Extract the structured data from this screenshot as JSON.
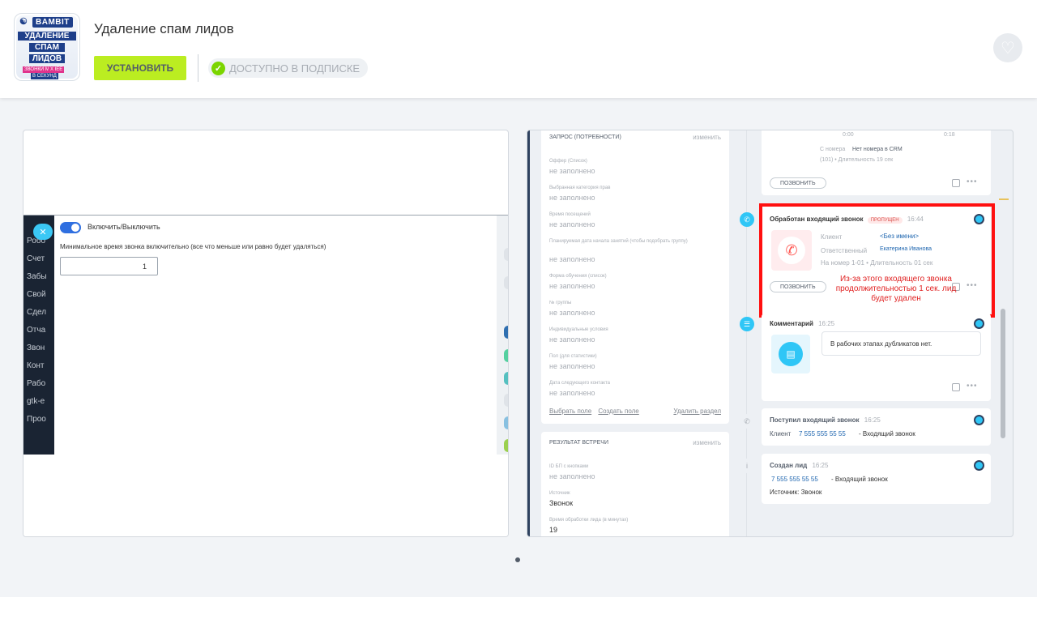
{
  "app": {
    "title": "Удаление спам лидов",
    "install_label": "УСТАНОВИТЬ",
    "subscription_label": "ДОСТУПНО В ПОДПИСКЕ",
    "logo": {
      "brand": "BAMBIT",
      "line1": "УДАЛЕНИЕ",
      "line2": "СПАМ",
      "line3": "ЛИДОВ",
      "tag1": "ЗВОНКИ МЕНЕЕ",
      "tag2": "Х",
      "tag3": "В СЕКУНД"
    },
    "icons": {
      "favorite": "heart-icon",
      "check": "check-icon"
    },
    "colors": {
      "install": "#bbed21",
      "check": "#7bd500",
      "toggle": "#2f6fe0",
      "highlight": "#ff1010"
    }
  },
  "slide1": {
    "sidebar_items": [
      "Робо",
      "Счет",
      "Забы",
      "Свой",
      "Сдел",
      "Отча",
      "Звон",
      "Конт",
      "Рабо",
      "gtk-e",
      "Проо"
    ],
    "toggle_label": "Включить/Выключить",
    "min_label": "Минимальное время звонка включительно (все что меньше или равно будет удаляться)",
    "min_value": "1"
  },
  "slide2": {
    "section1": {
      "title": "ЗАПРОС (ПОТРЕБНОСТИ)",
      "edit": "изменить",
      "fields": [
        {
          "label": "Оффер (Список)",
          "value": "не заполнено"
        },
        {
          "label": "Выбранная категория прав",
          "value": "не заполнено"
        },
        {
          "label": "Время посещений",
          "value": "не заполнено"
        },
        {
          "label": "Планируемая дата начала занятий (чтобы подобрать группу)",
          "value": "не заполнено"
        },
        {
          "label": "Форма обучения (список)",
          "value": "не заполнено"
        },
        {
          "label": "№ группы",
          "value": "не заполнено"
        },
        {
          "label": "Индивидуальные условия",
          "value": "не заполнено"
        },
        {
          "label": "Пол (для статистики)",
          "value": "не заполнено"
        },
        {
          "label": "Дата следующего контакта",
          "value": "не заполнено"
        }
      ],
      "select_field": "Выбрать поле",
      "create_field": "Создать поле",
      "delete_section": "Удалить раздел"
    },
    "section2": {
      "title": "РЕЗУЛЬТАТ ВСТРЕЧИ",
      "edit": "изменить",
      "fields": [
        {
          "label": "ID БП с кнопками",
          "value": "не заполнено"
        },
        {
          "label": "Источник",
          "value": "Звонок"
        },
        {
          "label": "Время обработки лида (в минутах)",
          "value": "19"
        }
      ]
    },
    "timeline": {
      "top_card": {
        "t0": "0:00",
        "t1": "0:18",
        "from_label": "С номера",
        "from_value": "Нет номера в CRM",
        "duration": "(101) • Длительность 19 сек",
        "call_btn": "ПОЗВОНИТЬ"
      },
      "processed_call": {
        "title": "Обработан входящий звонок",
        "badge": "ПРОПУЩЕН",
        "time": "16:44",
        "client_label": "Клиент",
        "client_value": "<Без имени>",
        "resp_label": "Ответственный",
        "resp_value": "Екатерина Иванова",
        "number": "На номер 1-01 • Длительность 01 сек",
        "call_btn": "ПОЗВОНИТЬ",
        "note": "Из-за этого входящего звонка продолжительностью 1 сек. лид будет удален"
      },
      "comment": {
        "title": "Комментарий",
        "time": "16:25",
        "text": "В рабочих этапах дубликатов нет."
      },
      "incoming": {
        "title": "Поступил входящий звонок",
        "time": "16:25",
        "client_label": "Клиент",
        "phone": "7 555 555 55 55",
        "suffix": "- Входящий звонок"
      },
      "lead_created": {
        "title": "Создан лид",
        "time": "16:25",
        "phone": "7 555 555 55 55",
        "suffix": "- Входящий звонок",
        "source": "Источник: Звонок"
      }
    }
  }
}
